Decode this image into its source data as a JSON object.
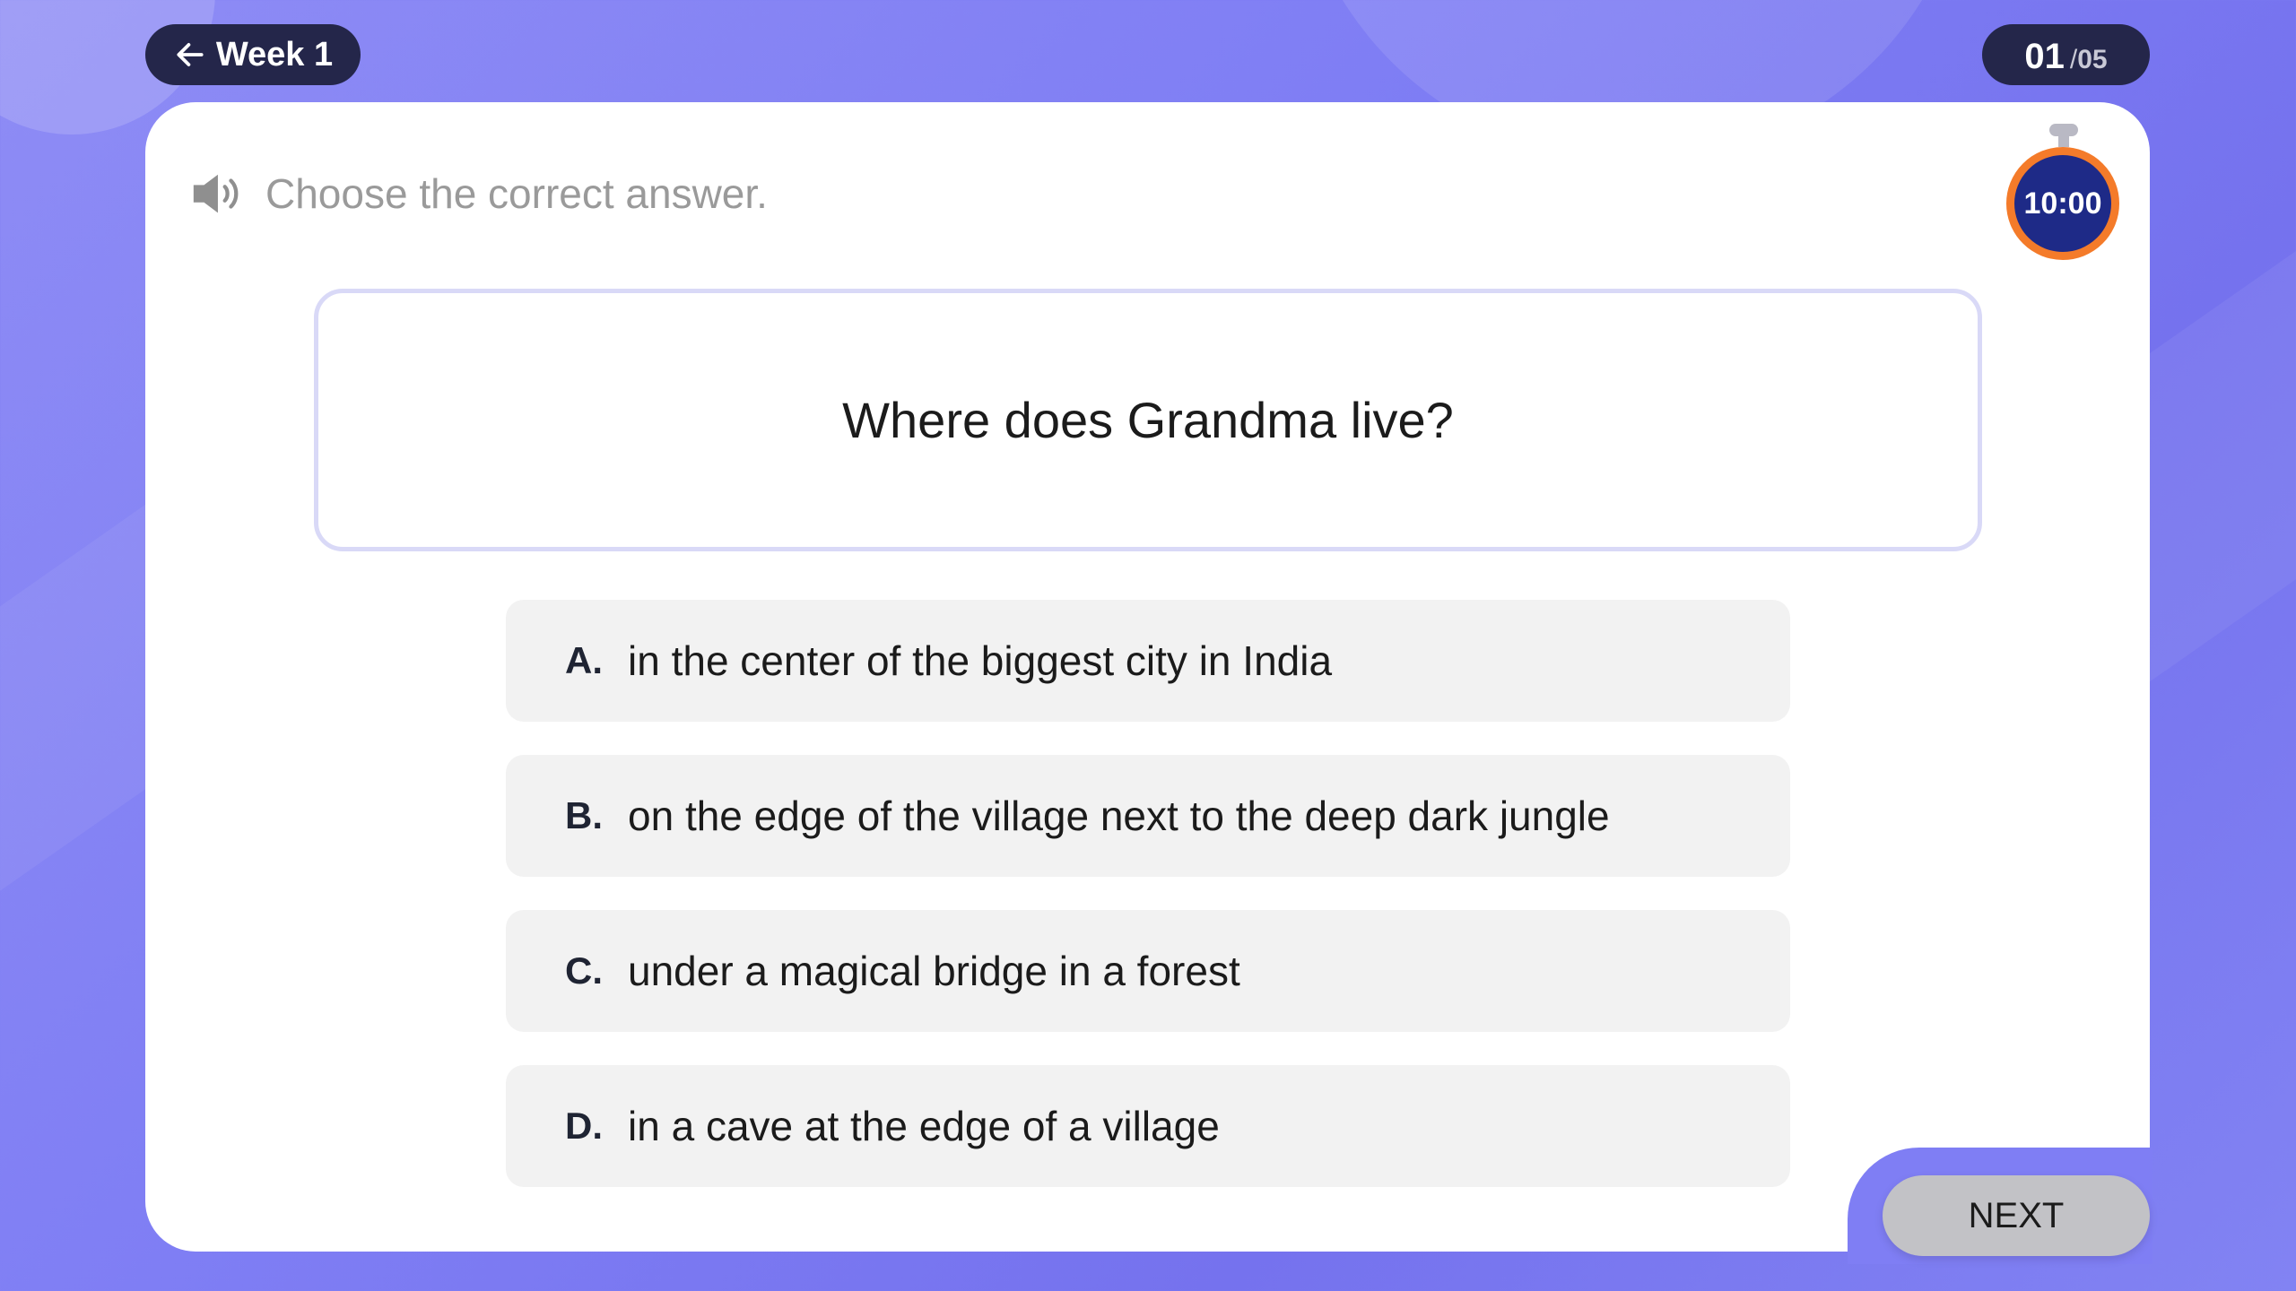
{
  "header": {
    "back_label": "Week 1",
    "counter_current": "01",
    "counter_separator": "/",
    "counter_total": "05"
  },
  "instruction": {
    "text": "Choose the correct answer."
  },
  "timer": {
    "value": "10:00"
  },
  "question": {
    "text": "Where does Grandma live?"
  },
  "options": [
    {
      "letter": "A.",
      "text": "in the center of the biggest city in India"
    },
    {
      "letter": "B.",
      "text": "on the edge of the village next to the deep dark jungle"
    },
    {
      "letter": "C.",
      "text": "under a magical bridge in a forest"
    },
    {
      "letter": "D.",
      "text": "in a cave at the edge of a village"
    }
  ],
  "footer": {
    "next_label": "NEXT"
  },
  "colors": {
    "background": "#7f7ef4",
    "pill_dark": "#24264a",
    "timer_fill": "#1e2a87",
    "timer_ring": "#f47b2a",
    "option_bg": "#f2f2f2",
    "next_bg": "#c2c2c6"
  }
}
